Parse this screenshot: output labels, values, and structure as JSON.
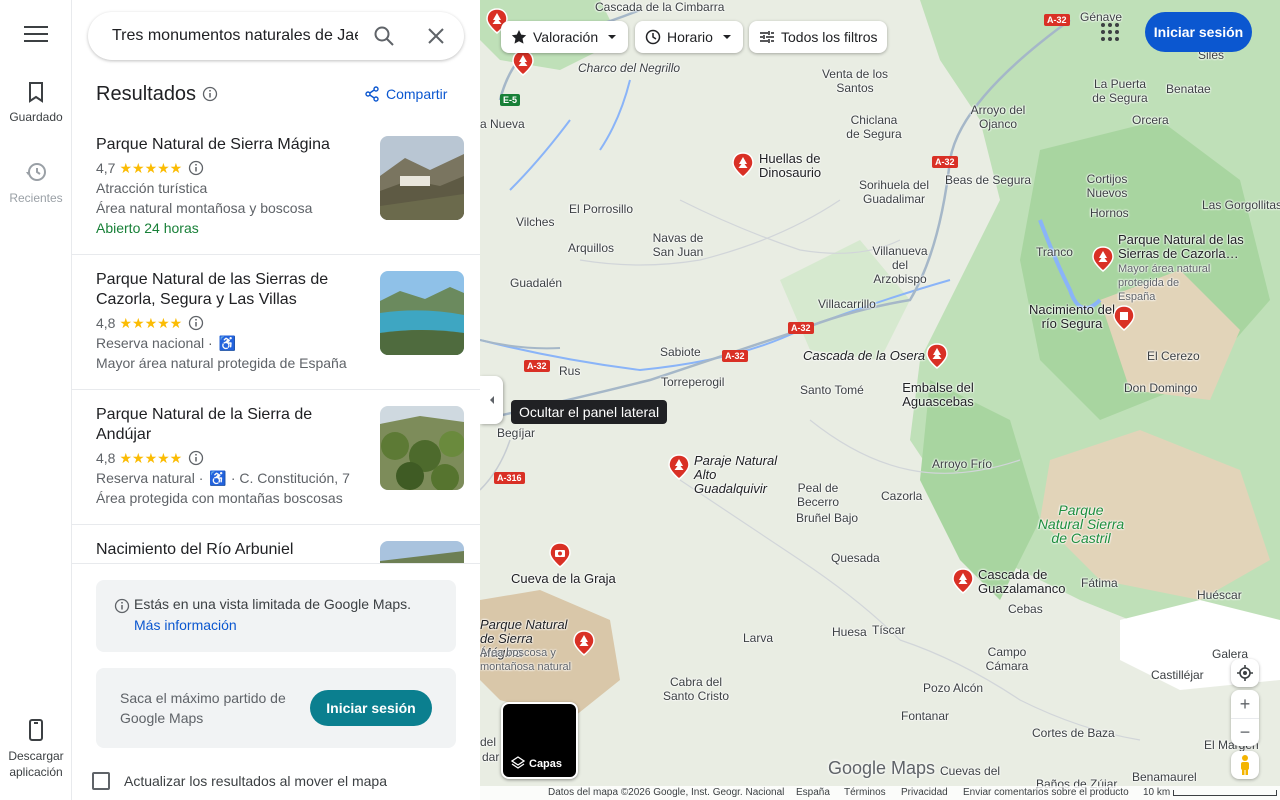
{
  "rail": {
    "saved_label": "Guardado",
    "recent_label": "Recientes",
    "download_label": "Descargar aplicación"
  },
  "search": {
    "value": "Tres monumentos naturales de Jaén"
  },
  "results": {
    "title": "Resultados",
    "share_label": "Compartir",
    "items": [
      {
        "name": "Parque Natural de Sierra Mágina",
        "rating": "4,7",
        "stars": "★★★★★",
        "category": "Atracción turística",
        "description": "Área natural montañosa y boscosa",
        "hours": "Abierto 24 horas"
      },
      {
        "name": "Parque Natural de las Sierras de Cazorla, Segura y Las Villas",
        "rating": "4,8",
        "stars": "★★★★★",
        "category": "Reserva nacional ·",
        "description": "Mayor área natural protegida de España"
      },
      {
        "name": "Parque Natural de la Sierra de Andújar",
        "rating": "4,8",
        "stars": "★★★★★",
        "category": "Reserva natural ·",
        "address": "· C. Constitución, 7",
        "description": "Área protegida con montañas boscosas"
      },
      {
        "name": "Nacimiento del Río Arbuniel"
      }
    ]
  },
  "limited": {
    "text": "Estás en una vista limitada de Google Maps.",
    "link": "Más información"
  },
  "promo": {
    "text": "Saca el máximo partido de Google Maps",
    "button": "Iniciar sesión"
  },
  "update_label": "Actualizar los resultados al mover el mapa",
  "map": {
    "filters": [
      "Valoración",
      "Horario",
      "Todos los filtros"
    ],
    "signin": "Iniciar sesión",
    "tooltip": "Ocultar el panel lateral",
    "layers": "Capas",
    "logo": "Google Maps",
    "footer": {
      "data": "Datos del mapa ©2026 Google, Inst. Geogr. Nacional",
      "country": "España",
      "terms": "Términos",
      "privacy": "Privacidad",
      "feedback": "Enviar comentarios sobre el producto",
      "scale": "10 km"
    },
    "places": {
      "cascada_cimbarra": "Cascada de la Cimbarra",
      "charco_negrillo": "Charco del Negrillo",
      "venta_santos": "Venta de los Santos",
      "genave": "Génave",
      "siles": "Siles",
      "puerta_segura": "La Puerta de Segura",
      "benatae": "Benatae",
      "arroyo_ojanco": "Arroyo del Ojanco",
      "orcera": "Orcera",
      "chiclana": "Chiclana de Segura",
      "huellas": "Huellas de Dinosaurio",
      "sorihuela": "Sorihuela del Guadalimar",
      "beas": "Beas de Segura",
      "cortijos_nuevos": "Cortijos Nuevos",
      "hornos": "Hornos",
      "gorgollitas": "Las Gorgollitas",
      "nueva": "a Nueva",
      "porrosillo": "El Porrosillo",
      "vilches": "Vilches",
      "navas": "Navas de San Juan",
      "arquillos": "Arquillos",
      "villanueva": "Villanueva del Arzobispo",
      "tranco": "Tranco",
      "parque_cazorla": "Parque Natural de las Sierras de Cazorla…",
      "parque_cazorla_sub": "Mayor área natural protegida de España",
      "guadalen": "Guadalén",
      "villacarrillo": "Villacarrillo",
      "nacimiento_segura": "Nacimiento del río Segura",
      "sabiote": "Sabiote",
      "cascada_osera": "Cascada de la Osera",
      "el_cerezo": "El Cerezo",
      "rus": "Rus",
      "torreperogil": "Torreperogil",
      "santo_tome": "Santo Tomé",
      "embalse": "Embalse del Aguascebas",
      "don_domingo": "Don Domingo",
      "begijar": "Begíjar",
      "arroyo_frio": "Arroyo Frío",
      "paraje": "Paraje Natural Alto Guadalquivir",
      "peal": "Peal de Becerro",
      "cazorla": "Cazorla",
      "brunel": "Bruñel Bajo",
      "parque_castril": "Parque Natural Sierra de Castril",
      "cueva_graja": "Cueva de la Graja",
      "quesada": "Quesada",
      "cascada_guadalamanco": "Cascada de Guazalamanco",
      "fatima": "Fátima",
      "cebas": "Cebas",
      "huescar": "Huéscar",
      "parque_magina": "Parque Natural de Sierra Mágina",
      "parque_magina_sub": "Área boscosa y montañosa natural",
      "larva": "Larva",
      "huesa": "Huesa",
      "tiscar": "Tíscar",
      "campo_camara": "Campo Cámara",
      "galera": "Galera",
      "castillejar": "Castilléjar",
      "cabra": "Cabra del Santo Cristo",
      "pozo_alcon": "Pozo Alcón",
      "fontanar": "Fontanar",
      "cortes": "Cortes de Baza",
      "el_margen": "El Margen",
      "del": "del",
      "jodar": "dar",
      "cuevas": "Cuevas del",
      "banos": "Baños de Zújar",
      "benamaurel": "Benamaurel"
    },
    "roads": [
      "A-32",
      "E-5",
      "A-32",
      "A-32",
      "A-32",
      "A-32",
      "A-316"
    ]
  },
  "colors": {
    "accent": "#0b57d0",
    "teal_button": "#0b7f8f",
    "pin": "#d93025",
    "park_text": "#1e8e3e",
    "star": "#fbbc04"
  }
}
